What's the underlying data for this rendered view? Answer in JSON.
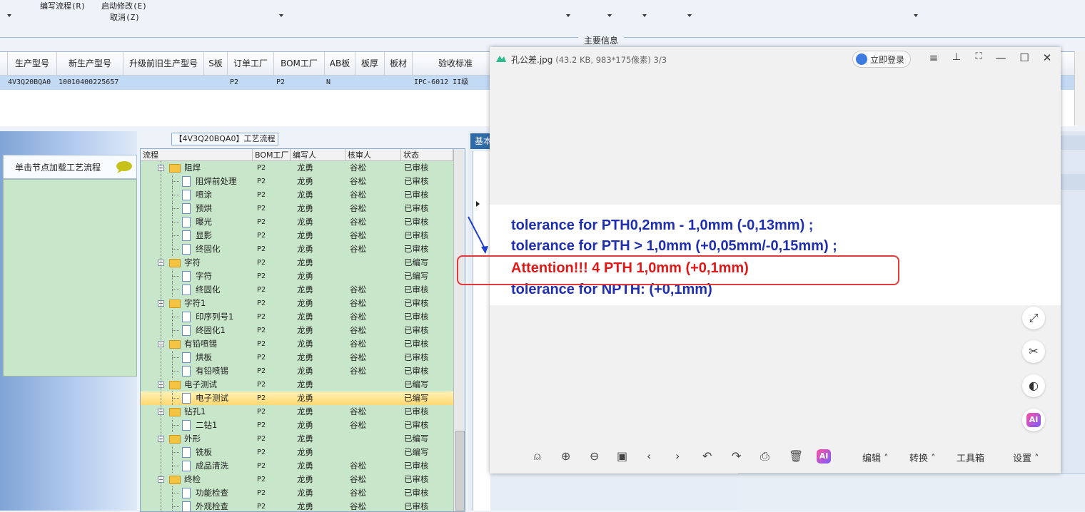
{
  "toolbar": {
    "edit_process": "编写流程(R)",
    "start_modify": "启动修改(E)",
    "cancel": "取消(Z)",
    "main_info": "主要信息"
  },
  "product_table": {
    "headers": [
      "生产型号",
      "新生产型号",
      "升级前旧生产型号",
      "S板",
      "订单工厂",
      "BOM工厂",
      "AB板",
      "板厚",
      "板材",
      "验收标准"
    ],
    "row": [
      "4V3Q20BQA0",
      "10010400225657",
      "",
      "",
      "P2",
      "P2",
      "N",
      "",
      "",
      "IPC-6012 II级"
    ]
  },
  "left_panel": {
    "load_button": "单击节点加载工艺流程"
  },
  "process": {
    "title": "【4V3Q20BQA0】工艺流程",
    "headers": [
      "流程",
      "BOM工厂",
      "编写人",
      "核审人",
      "状态"
    ],
    "rows": [
      {
        "name": "阻焊",
        "factory": "P2",
        "author": "龙勇",
        "reviewer": "谷松",
        "status": "已审核",
        "level": 0
      },
      {
        "name": "阻焊前处理",
        "factory": "P2",
        "author": "龙勇",
        "reviewer": "谷松",
        "status": "已审核",
        "level": 1
      },
      {
        "name": "喷涂",
        "factory": "P2",
        "author": "龙勇",
        "reviewer": "谷松",
        "status": "已审核",
        "level": 1
      },
      {
        "name": "预烘",
        "factory": "P2",
        "author": "龙勇",
        "reviewer": "谷松",
        "status": "已审核",
        "level": 1
      },
      {
        "name": "曝光",
        "factory": "P2",
        "author": "龙勇",
        "reviewer": "谷松",
        "status": "已审核",
        "level": 1
      },
      {
        "name": "显影",
        "factory": "P2",
        "author": "龙勇",
        "reviewer": "谷松",
        "status": "已审核",
        "level": 1
      },
      {
        "name": "终固化",
        "factory": "P2",
        "author": "龙勇",
        "reviewer": "谷松",
        "status": "已审核",
        "level": 1
      },
      {
        "name": "字符",
        "factory": "P2",
        "author": "龙勇",
        "reviewer": "",
        "status": "已编写",
        "level": 0
      },
      {
        "name": "字符",
        "factory": "P2",
        "author": "龙勇",
        "reviewer": "",
        "status": "已编写",
        "level": 1
      },
      {
        "name": "终固化",
        "factory": "P2",
        "author": "龙勇",
        "reviewer": "谷松",
        "status": "已审核",
        "level": 1
      },
      {
        "name": "字符1",
        "factory": "P2",
        "author": "龙勇",
        "reviewer": "谷松",
        "status": "已审核",
        "level": 0
      },
      {
        "name": "印序列号1",
        "factory": "P2",
        "author": "龙勇",
        "reviewer": "谷松",
        "status": "已审核",
        "level": 1
      },
      {
        "name": "终固化1",
        "factory": "P2",
        "author": "龙勇",
        "reviewer": "谷松",
        "status": "已审核",
        "level": 1
      },
      {
        "name": "有铅喷锡",
        "factory": "P2",
        "author": "龙勇",
        "reviewer": "谷松",
        "status": "已审核",
        "level": 0
      },
      {
        "name": "烘板",
        "factory": "P2",
        "author": "龙勇",
        "reviewer": "谷松",
        "status": "已审核",
        "level": 1
      },
      {
        "name": "有铅喷锡",
        "factory": "P2",
        "author": "龙勇",
        "reviewer": "谷松",
        "status": "已审核",
        "level": 1
      },
      {
        "name": "电子测试",
        "factory": "P2",
        "author": "龙勇",
        "reviewer": "",
        "status": "已编写",
        "level": 0
      },
      {
        "name": "电子测试",
        "factory": "P2",
        "author": "龙勇",
        "reviewer": "",
        "status": "已编写",
        "level": 1,
        "selected": true
      },
      {
        "name": "钻孔1",
        "factory": "P2",
        "author": "龙勇",
        "reviewer": "谷松",
        "status": "已审核",
        "level": 0
      },
      {
        "name": "二钻1",
        "factory": "P2",
        "author": "龙勇",
        "reviewer": "谷松",
        "status": "已审核",
        "level": 1
      },
      {
        "name": "外形",
        "factory": "P2",
        "author": "龙勇",
        "reviewer": "",
        "status": "已编写",
        "level": 0
      },
      {
        "name": "铣板",
        "factory": "P2",
        "author": "龙勇",
        "reviewer": "",
        "status": "已编写",
        "level": 1
      },
      {
        "name": "成品清洗",
        "factory": "P2",
        "author": "龙勇",
        "reviewer": "谷松",
        "status": "已审核",
        "level": 1
      },
      {
        "name": "终检",
        "factory": "P2",
        "author": "龙勇",
        "reviewer": "谷松",
        "status": "已审核",
        "level": 0
      },
      {
        "name": "功能检查",
        "factory": "P2",
        "author": "龙勇",
        "reviewer": "谷松",
        "status": "已审核",
        "level": 1
      },
      {
        "name": "外观检查",
        "factory": "P2",
        "author": "龙勇",
        "reviewer": "谷松",
        "status": "已审核",
        "level": 1
      }
    ]
  },
  "right_panel": {
    "tab_label": "基本"
  },
  "viewer": {
    "filename": "孔公差.jpg",
    "meta": "(43.2 KB, 983*175像素) 3/3",
    "login_label": "立即登录",
    "image_lines": [
      "tolerance for PTH0,2mm - 1,0mm  (-0,13mm)  ;",
      "tolerance for PTH > 1,0mm  (+0,05mm/-0,15mm)  ;",
      "Attention!!!  4 PTH 1,0mm (+0,1mm)",
      "tolerance for NPTH: (+0,1mm)"
    ],
    "ai_label": "AI",
    "bottom": {
      "edit": "编辑",
      "convert": "转换",
      "toolbox": "工具箱",
      "settings": "设置"
    }
  },
  "colors": {
    "tree_bg": "#c8e6c9",
    "selection": "#ffd870",
    "text_blue": "#1f2fb0",
    "attention_red": "#e01818"
  }
}
